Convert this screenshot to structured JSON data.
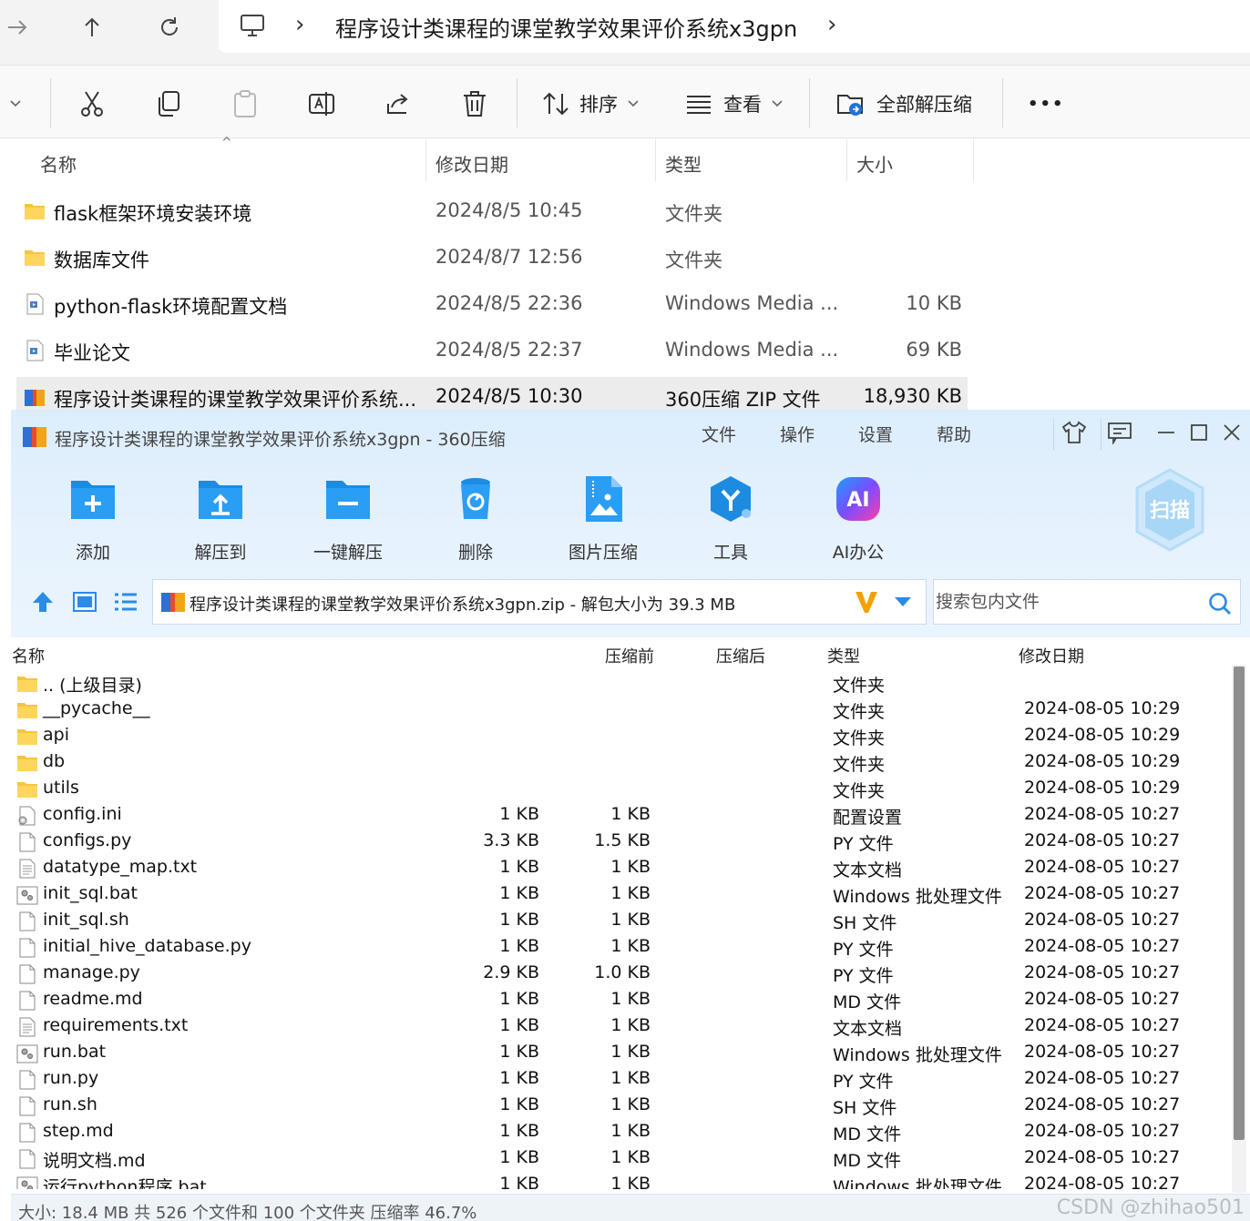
{
  "explorer": {
    "address": "程序设计类课程的课堂教学效果评价系统x3gpn",
    "cmdbar": {
      "sort_label": "排序",
      "view_label": "查看",
      "extract_all_label": "全部解压缩",
      "more_label": "•••"
    },
    "columns": {
      "name": "名称",
      "date": "修改日期",
      "type": "类型",
      "size": "大小"
    },
    "rows": [
      {
        "name": "flask框架环境安装环境",
        "date": "2024/8/5 10:45",
        "type": "文件夹",
        "size": "",
        "icon": "folder-icon"
      },
      {
        "name": "数据库文件",
        "date": "2024/8/7 12:56",
        "type": "文件夹",
        "size": "",
        "icon": "folder-icon"
      },
      {
        "name": "python-flask环境配置文档",
        "date": "2024/8/5 22:36",
        "type": "Windows Media ...",
        "size": "10 KB",
        "icon": "media-file-icon"
      },
      {
        "name": "毕业论文",
        "date": "2024/8/5 22:37",
        "type": "Windows Media ...",
        "size": "69 KB",
        "icon": "media-file-icon"
      },
      {
        "name": "程序设计类课程的课堂教学效果评价系统...",
        "date": "2024/8/5 10:30",
        "type": "360压缩 ZIP 文件",
        "size": "18,930 KB",
        "icon": "zip-archive-icon"
      }
    ]
  },
  "zip": {
    "title": "程序设计类课程的课堂教学效果评价系统x3gpn - 360压缩",
    "menu": [
      "文件",
      "操作",
      "设置",
      "帮助"
    ],
    "tools": [
      "添加",
      "解压到",
      "一键解压",
      "删除",
      "图片压缩",
      "工具",
      "AI办公"
    ],
    "scan_label": "扫描",
    "ai_badge": "AI",
    "path": "程序设计类课程的课堂教学效果评价系统x3gpn.zip - 解包大小为 39.3 MB",
    "search_placeholder": "搜索包内文件",
    "columns": {
      "name": "名称",
      "before": "压缩前",
      "after": "压缩后",
      "type": "类型",
      "date": "修改日期"
    },
    "rows": [
      {
        "name": ".. (上级目录)",
        "before": "",
        "after": "",
        "type": "文件夹",
        "date": "",
        "icon": "folder-icon"
      },
      {
        "name": "__pycache__",
        "before": "",
        "after": "",
        "type": "文件夹",
        "date": "2024-08-05 10:29",
        "icon": "folder-icon"
      },
      {
        "name": "api",
        "before": "",
        "after": "",
        "type": "文件夹",
        "date": "2024-08-05 10:29",
        "icon": "folder-icon"
      },
      {
        "name": "db",
        "before": "",
        "after": "",
        "type": "文件夹",
        "date": "2024-08-05 10:29",
        "icon": "folder-icon"
      },
      {
        "name": "utils",
        "before": "",
        "after": "",
        "type": "文件夹",
        "date": "2024-08-05 10:29",
        "icon": "folder-icon"
      },
      {
        "name": "config.ini",
        "before": "1 KB",
        "after": "1 KB",
        "type": "配置设置",
        "date": "2024-08-05 10:27",
        "icon": "settings-file-icon"
      },
      {
        "name": "configs.py",
        "before": "3.3 KB",
        "after": "1.5 KB",
        "type": "PY 文件",
        "date": "2024-08-05 10:27",
        "icon": "file-icon"
      },
      {
        "name": "datatype_map.txt",
        "before": "1 KB",
        "after": "1 KB",
        "type": "文本文档",
        "date": "2024-08-05 10:27",
        "icon": "text-file-icon"
      },
      {
        "name": "init_sql.bat",
        "before": "1 KB",
        "after": "1 KB",
        "type": "Windows 批处理文件",
        "date": "2024-08-05 10:27",
        "icon": "batch-file-icon"
      },
      {
        "name": "init_sql.sh",
        "before": "1 KB",
        "after": "1 KB",
        "type": "SH 文件",
        "date": "2024-08-05 10:27",
        "icon": "file-icon"
      },
      {
        "name": "initial_hive_database.py",
        "before": "1 KB",
        "after": "1 KB",
        "type": "PY 文件",
        "date": "2024-08-05 10:27",
        "icon": "file-icon"
      },
      {
        "name": "manage.py",
        "before": "2.9 KB",
        "after": "1.0 KB",
        "type": "PY 文件",
        "date": "2024-08-05 10:27",
        "icon": "file-icon"
      },
      {
        "name": "readme.md",
        "before": "1 KB",
        "after": "1 KB",
        "type": "MD 文件",
        "date": "2024-08-05 10:27",
        "icon": "file-icon"
      },
      {
        "name": "requirements.txt",
        "before": "1 KB",
        "after": "1 KB",
        "type": "文本文档",
        "date": "2024-08-05 10:27",
        "icon": "text-file-icon"
      },
      {
        "name": "run.bat",
        "before": "1 KB",
        "after": "1 KB",
        "type": "Windows 批处理文件",
        "date": "2024-08-05 10:27",
        "icon": "batch-file-icon"
      },
      {
        "name": "run.py",
        "before": "1 KB",
        "after": "1 KB",
        "type": "PY 文件",
        "date": "2024-08-05 10:27",
        "icon": "file-icon"
      },
      {
        "name": "run.sh",
        "before": "1 KB",
        "after": "1 KB",
        "type": "SH 文件",
        "date": "2024-08-05 10:27",
        "icon": "file-icon"
      },
      {
        "name": "step.md",
        "before": "1 KB",
        "after": "1 KB",
        "type": "MD 文件",
        "date": "2024-08-05 10:27",
        "icon": "file-icon"
      },
      {
        "name": "说明文档.md",
        "before": "1 KB",
        "after": "1 KB",
        "type": "MD 文件",
        "date": "2024-08-05 10:27",
        "icon": "file-icon"
      },
      {
        "name": "运行python程序.bat",
        "before": "1 KB",
        "after": "1 KB",
        "type": "Windows 批处理文件",
        "date": "2024-08-05 10:27",
        "icon": "batch-file-icon"
      }
    ],
    "status": "大小: 18.4 MB 共 526 个文件和 100 个文件夹 压缩率 46.7%",
    "watermark": "CSDN @zhihao501"
  }
}
